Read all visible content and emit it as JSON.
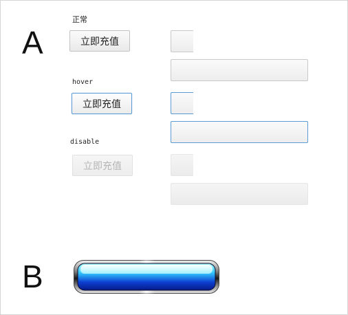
{
  "sections": {
    "a_letter": "A",
    "b_letter": "B"
  },
  "states": {
    "normal": {
      "label": "正常",
      "button_label": "立即充值"
    },
    "hover": {
      "label": "hover",
      "button_label": "立即充值"
    },
    "disabled": {
      "label": "disable",
      "button_label": "立即充值"
    }
  },
  "colors": {
    "hover_border": "#5a9bd5",
    "bar_fill_top": "#8ff6ff",
    "bar_fill_bottom": "#0a1a9a"
  }
}
